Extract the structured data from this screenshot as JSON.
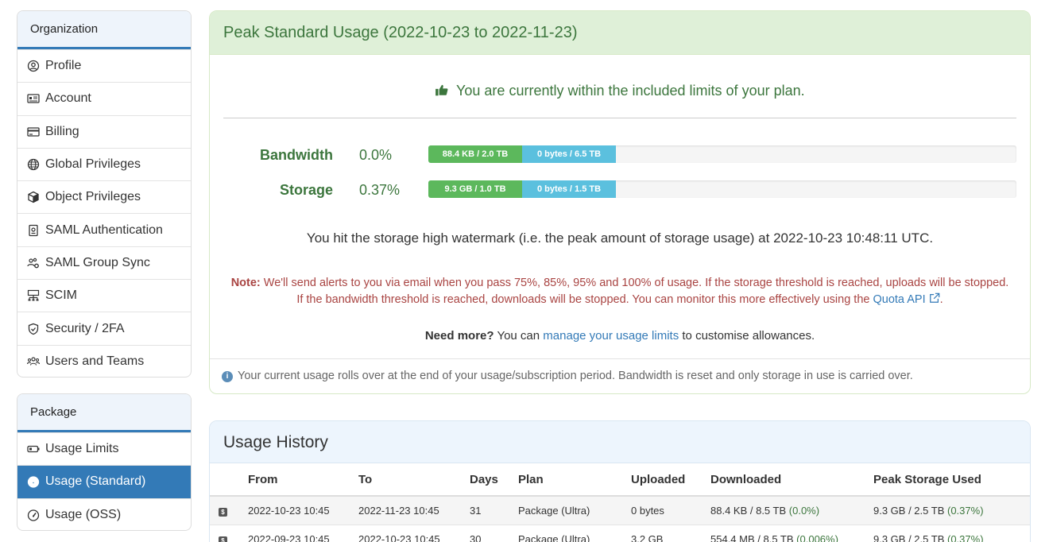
{
  "sidebar": {
    "org_title": "Organization",
    "org_items": [
      {
        "label": "Profile",
        "icon": "profile-icon"
      },
      {
        "label": "Account",
        "icon": "account-card-icon"
      },
      {
        "label": "Billing",
        "icon": "credit-card-icon"
      },
      {
        "label": "Global Privileges",
        "icon": "globe-icon"
      },
      {
        "label": "Object Privileges",
        "icon": "cube-icon"
      },
      {
        "label": "SAML Authentication",
        "icon": "id-badge-icon"
      },
      {
        "label": "SAML Group Sync",
        "icon": "users-cog-icon"
      },
      {
        "label": "SCIM",
        "icon": "network-icon"
      },
      {
        "label": "Security / 2FA",
        "icon": "shield-icon"
      },
      {
        "label": "Users and Teams",
        "icon": "users-icon"
      }
    ],
    "pkg_title": "Package",
    "pkg_items": [
      {
        "label": "Usage Limits",
        "icon": "battery-icon"
      },
      {
        "label": "Usage (Standard)",
        "icon": "gauge-icon",
        "active": true
      },
      {
        "label": "Usage (OSS)",
        "icon": "gauge-icon"
      }
    ]
  },
  "usage": {
    "title": "Peak Standard Usage (2022-10-23 to 2022-11-23)",
    "within_text": "You are currently within the included limits of your plan.",
    "bandwidth": {
      "label": "Bandwidth",
      "pct": "0.0%",
      "seg1": "88.4 KB / 2.0 TB",
      "seg2": "0 bytes / 6.5 TB"
    },
    "storage": {
      "label": "Storage",
      "pct": "0.37%",
      "seg1": "9.3 GB / 1.0 TB",
      "seg2": "0 bytes / 1.5 TB"
    },
    "watermark": "You hit the storage high watermark (i.e. the peak amount of storage usage) at 2022-10-23 10:48:11 UTC.",
    "note_label": "Note:",
    "note_text": "We'll send alerts to you via email when you pass 75%, 85%, 95% and 100% of usage. If the storage threshold is reached, uploads will be stopped. If the bandwidth threshold is reached, downloads will be stopped. You can monitor this more effectively using the",
    "quota_link": "Quota API",
    "need_more": "Need more?",
    "you_can": "You can",
    "manage_link": "manage your usage limits",
    "customise": "to customise allowances.",
    "footer": "Your current usage rolls over at the end of your usage/subscription period. Bandwidth is reset and only storage in use is carried over."
  },
  "history": {
    "title": "Usage History",
    "columns": [
      "From",
      "To",
      "Days",
      "Plan",
      "Uploaded",
      "Downloaded",
      "Peak Storage Used"
    ],
    "rows": [
      {
        "from": "2022-10-23 10:45",
        "to": "2022-11-23 10:45",
        "days": "31",
        "plan": "Package (Ultra)",
        "uploaded": "0 bytes",
        "downloaded": "88.4 KB / 8.5 TB",
        "dl_pct": "(0.0%)",
        "storage": "9.3 GB / 2.5 TB",
        "st_pct": "(0.37%)"
      },
      {
        "from": "2022-09-23 10:45",
        "to": "2022-10-23 10:45",
        "days": "30",
        "plan": "Package (Ultra)",
        "uploaded": "3.2 GB",
        "downloaded": "554.4 MB / 8.5 TB",
        "dl_pct": "(0.006%)",
        "storage": "9.3 GB / 2.5 TB",
        "st_pct": "(0.37%)"
      }
    ]
  }
}
